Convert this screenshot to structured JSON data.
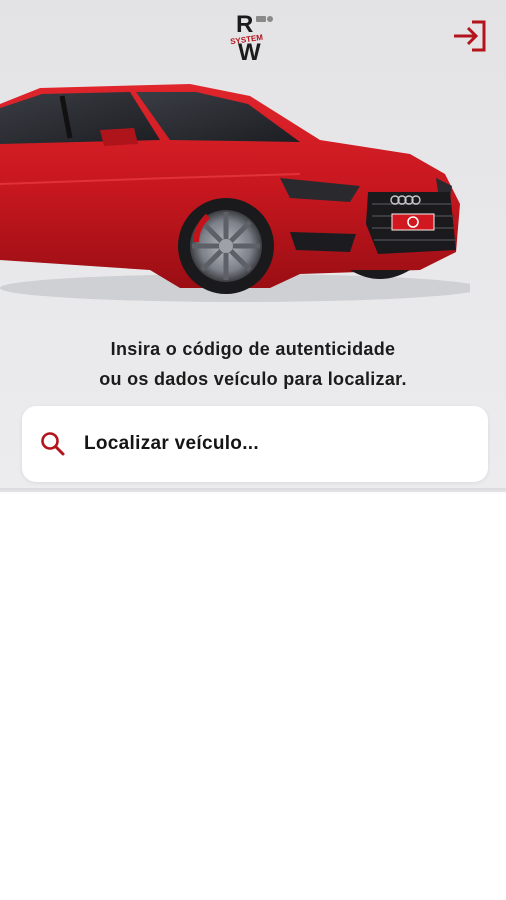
{
  "header": {
    "logo_letters": "RW",
    "logo_word": "SYSTEM",
    "logout_icon": "logout-icon"
  },
  "hero": {
    "image": "red-sedan-car",
    "plate_badge_icon": "brand-badge-icon"
  },
  "prompt": {
    "line1": "Insira o código de autenticidade",
    "line2": "ou os dados veículo para localizar."
  },
  "search": {
    "placeholder": "Localizar veículo...",
    "icon": "search-icon"
  },
  "colors": {
    "accent": "#b3141c",
    "hero_bg": "#e6e6e8",
    "text": "#1b1b1b",
    "card": "#ffffff"
  }
}
